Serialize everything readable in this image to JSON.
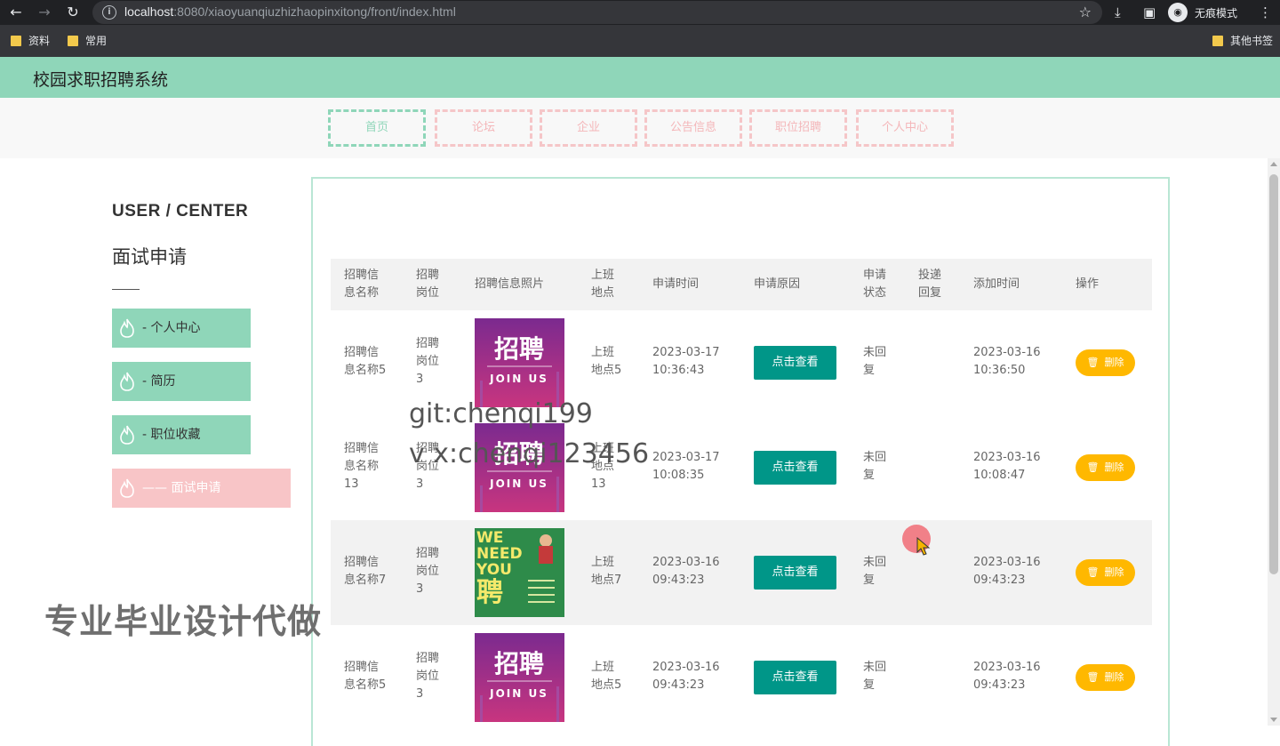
{
  "browser": {
    "url_host": "localhost",
    "url_rest": ":8080/xiaoyuanqiuzhizhaopinxitong/front/index.html",
    "incognito_label": "无痕模式",
    "bookmarks": [
      "资料",
      "常用"
    ],
    "other_bookmarks": "其他书签"
  },
  "site": {
    "title": "校园求职招聘系统",
    "nav": [
      "首页",
      "论坛",
      "企业",
      "公告信息",
      "职位招聘",
      "个人中心"
    ]
  },
  "sidebar": {
    "title": "USER / CENTER",
    "subtitle": "面试申请",
    "items": [
      {
        "label": "- 个人中心"
      },
      {
        "label": "- 简历"
      },
      {
        "label": "- 职位收藏"
      },
      {
        "label": "—— 面试申请"
      }
    ]
  },
  "table": {
    "headers": {
      "name": [
        "招聘信",
        "息名称"
      ],
      "post": [
        "招聘",
        "岗位"
      ],
      "photo": [
        "招聘信息照片"
      ],
      "place": [
        "上班",
        "地点"
      ],
      "apply_time": [
        "申请时间"
      ],
      "reason": [
        "申请原因"
      ],
      "status": [
        "申请",
        "状态"
      ],
      "reply": [
        "投递",
        "回复"
      ],
      "add_time": [
        "添加时间"
      ],
      "action": [
        "操作"
      ]
    },
    "view_label": "点击查看",
    "delete_label": "删除",
    "rows": [
      {
        "name": [
          "招聘信",
          "息名称5"
        ],
        "post": [
          "招聘",
          "岗位",
          "3"
        ],
        "poster": "join",
        "place": [
          "上班",
          "地点5"
        ],
        "apply_time": [
          "2023-03-17",
          "10:36:43"
        ],
        "status": [
          "未回",
          "复"
        ],
        "add_time": [
          "2023-03-16",
          "10:36:50"
        ]
      },
      {
        "name": [
          "招聘信",
          "息名称",
          "13"
        ],
        "post": [
          "招聘",
          "岗位",
          "3"
        ],
        "poster": "join",
        "place": [
          "上班",
          "地点",
          "13"
        ],
        "apply_time": [
          "2023-03-17",
          "10:08:35"
        ],
        "status": [
          "未回",
          "复"
        ],
        "add_time": [
          "2023-03-16",
          "10:08:47"
        ]
      },
      {
        "name": [
          "招聘信",
          "息名称7"
        ],
        "post": [
          "招聘",
          "岗位",
          "3"
        ],
        "poster": "need",
        "place": [
          "上班",
          "地点7"
        ],
        "apply_time": [
          "2023-03-16",
          "09:43:23"
        ],
        "status": [
          "未回",
          "复"
        ],
        "add_time": [
          "2023-03-16",
          "09:43:23"
        ]
      },
      {
        "name": [
          "招聘信",
          "息名称5"
        ],
        "post": [
          "招聘",
          "岗位",
          "3"
        ],
        "poster": "join",
        "place": [
          "上班",
          "地点5"
        ],
        "apply_time": [
          "2023-03-16",
          "09:43:23"
        ],
        "status": [
          "未回",
          "复"
        ],
        "add_time": [
          "2023-03-16",
          "09:43:23"
        ]
      }
    ]
  },
  "poster": {
    "join_big": "招聘",
    "join_small": "JOIN US",
    "need_lines": [
      "WE",
      "NEED",
      "YOU"
    ],
    "need_big": "聘"
  },
  "overlay": {
    "watermark1": "git:chenqi199",
    "watermark2": "v x:chenqi123456",
    "promo": "专业毕业设计代做"
  }
}
